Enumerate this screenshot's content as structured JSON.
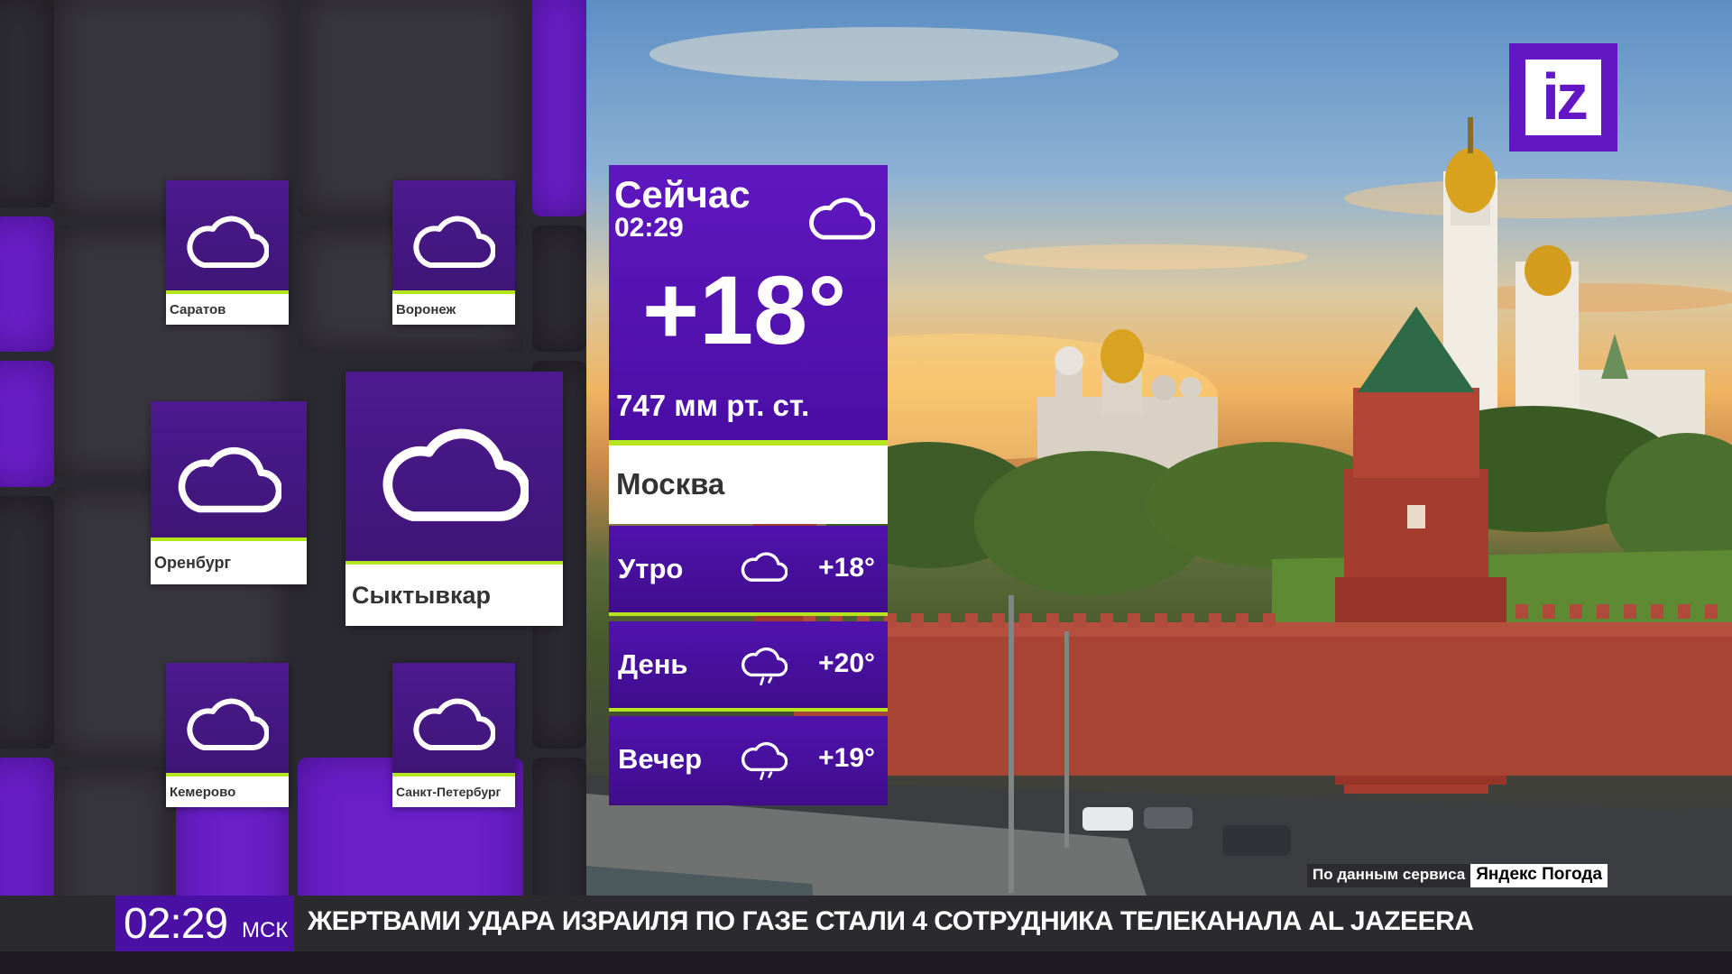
{
  "brand": {
    "logo_text": "iz",
    "accent_color": "#6317c4",
    "highlight_color": "#b5e61d"
  },
  "now": {
    "title": "Сейчас",
    "time": "02:29",
    "temperature": "+18°",
    "pressure": "747 мм рт. ст.",
    "icon": "cloud-icon",
    "city": "Москва"
  },
  "forecast": [
    {
      "label": "Утро",
      "temperature": "+18°",
      "icon": "cloud-icon"
    },
    {
      "label": "День",
      "temperature": "+20°",
      "icon": "cloud-rain-icon"
    },
    {
      "label": "Вечер",
      "temperature": "+19°",
      "icon": "cloud-rain-icon"
    }
  ],
  "cities": [
    {
      "name": "Саратов",
      "icon": "cloud-icon"
    },
    {
      "name": "Воронеж",
      "icon": "cloud-icon"
    },
    {
      "name": "Оренбург",
      "icon": "cloud-icon"
    },
    {
      "name": "Сыктывкар",
      "icon": "cloud-icon"
    },
    {
      "name": "Кемерово",
      "icon": "cloud-icon"
    },
    {
      "name": "Санкт-Петербург",
      "icon": "cloud-icon"
    }
  ],
  "source": {
    "prefix": "По данным сервиса",
    "name": "Яндекс Погода"
  },
  "ticker": {
    "clock": "02:29",
    "zone": "МСК",
    "headline": "ЖЕРТВАМИ УДАРА ИЗРАИЛЯ ПО ГАЗЕ СТАЛИ 4 СОТРУДНИКА ТЕЛЕКАНАЛА AL JAZEERA"
  }
}
